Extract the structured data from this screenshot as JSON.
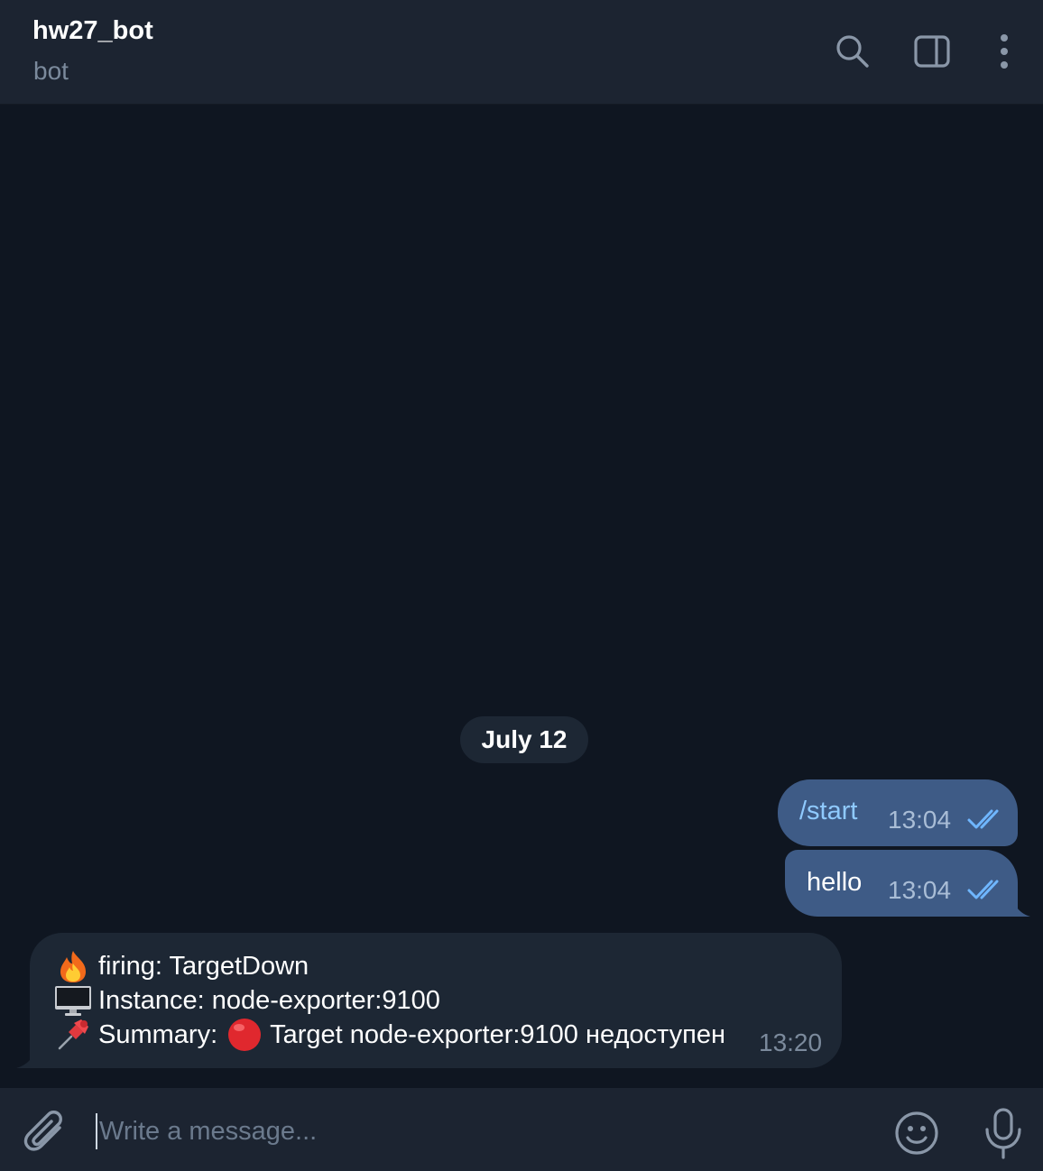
{
  "header": {
    "title": "hw27_bot",
    "subtitle": "bot",
    "icons": [
      "search-icon",
      "side-panel-icon",
      "more-vertical-icon"
    ]
  },
  "chat": {
    "date_separator": "July 12",
    "outgoing": [
      {
        "text": "/start",
        "time": "13:04",
        "status": "read"
      },
      {
        "text": "hello",
        "time": "13:04",
        "status": "read"
      }
    ],
    "incoming": {
      "lines": [
        {
          "emoji": "fire-emoji",
          "text": "firing: TargetDown"
        },
        {
          "emoji": "desktop-computer-emoji",
          "text": "Instance: node-exporter:9100"
        },
        {
          "emoji": "pushpin-emoji",
          "label": "Summary:",
          "emoji2": "red-circle-emoji",
          "text": "Target node-exporter:9100 недоступен"
        }
      ],
      "time": "13:20"
    }
  },
  "composer": {
    "placeholder": "Write a message...",
    "value": ""
  },
  "colors": {
    "background": "#0f1621",
    "header": "#1c2431",
    "outgoing_bubble": "#3e5b86",
    "incoming_bubble": "#1d2734",
    "command_link": "#8fcaff",
    "read_ticks": "#6fb6ff"
  }
}
